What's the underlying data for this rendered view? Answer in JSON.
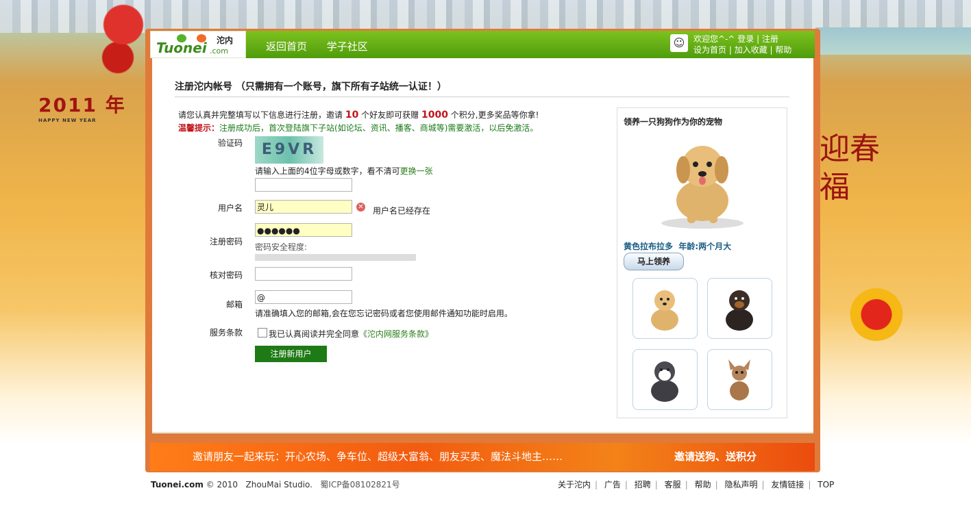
{
  "colors": {
    "header_green": "#5fa80f",
    "accent_red": "#c0141c",
    "link_green": "#2a7d1a",
    "submit_green": "#1e7a15",
    "banner_orange": "#f25c10"
  },
  "decor": {
    "newyear_year": "2011",
    "newyear_en": "HAPPY NEW YEAR",
    "newyear_cn": "年",
    "spring_text": "迎春福"
  },
  "logo": {
    "main": "Tuonei",
    "domain": ".com",
    "cn": "沱内"
  },
  "nav": {
    "home": "返回首页",
    "community": "学子社区"
  },
  "userbox": {
    "welcome": "欢迎您^-^",
    "login": "登录",
    "register": "注册",
    "set_home": "设为首页",
    "bookmark": "加入收藏",
    "help": "帮助",
    "avatar_icon": "user-avatar-icon"
  },
  "page": {
    "title": "注册沱内帐号 （只需拥有一个账号，旗下所有子站统一认证！）",
    "intro_prefix": "请您认真并完整填写以下信息进行注册，邀请",
    "intro_invite": "10",
    "intro_mid": "个好友即可获赠",
    "intro_points": "1000",
    "intro_suffix": "个积分,更多奖品等你拿!",
    "tip_label": "温馨提示：",
    "tip_text": "注册成功后，首次登陆旗下子站(如论坛、资讯、播客、商城等)需要激活，以后免激活。"
  },
  "form": {
    "captcha_label": "验证码",
    "captcha_image_text": "E9VR",
    "captcha_hint": "请输入上面的4位字母或数字，看不清可",
    "captcha_refresh": "更换一张",
    "captcha_value": "",
    "username_label": "用户名",
    "username_value": "灵儿",
    "username_error": "用户名已经存在",
    "password_label": "注册密码",
    "password_value": "●●●●●●",
    "password_strength": "密码安全程度:",
    "password_strength_level": 0,
    "confirm_label": "核对密码",
    "confirm_value": "",
    "email_label": "邮箱",
    "email_value": "@",
    "email_hint": "请准确填入您的邮箱,会在您忘记密码或者您使用邮件通知功能时启用。",
    "terms_label": "服务条款",
    "terms_text": "我已认真阅读并完全同意",
    "terms_link": "《沱内网服务条款》",
    "terms_checked": false,
    "submit": "注册新用户"
  },
  "pet": {
    "title": "领养一只狗狗作为你的宠物",
    "name": "黄色拉布拉多",
    "age": "年龄:两个月大",
    "claim_button": "马上领养",
    "thumbnails": [
      "labrador-puppy",
      "rottweiler-puppy",
      "husky-puppy",
      "chihuahua-puppy"
    ]
  },
  "banner": {
    "left": "邀请朋友一起来玩：开心农场、争车位、超级大富翁、朋友买卖、魔法斗地主……",
    "right": "邀请送狗、送积分"
  },
  "footer": {
    "brand": "Tuonei.com",
    "copyright": "© 2010",
    "studio": "ZhouMai Studio.",
    "icp": "蜀ICP备08102821号",
    "links": [
      "关于沱内",
      "广告",
      "招聘",
      "客服",
      "帮助",
      "隐私声明",
      "友情链接",
      "TOP"
    ]
  }
}
